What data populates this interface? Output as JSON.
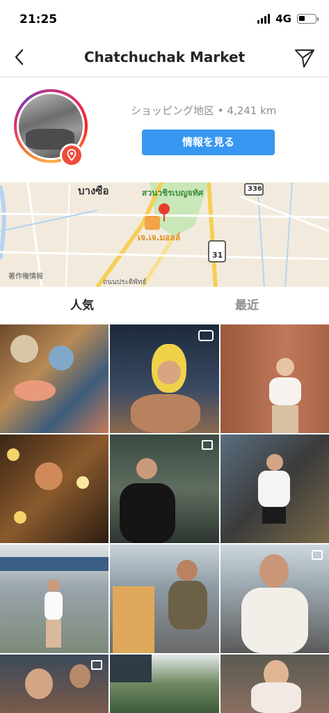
{
  "status_bar": {
    "time": "21:25",
    "network": "4G",
    "battery_level": 0.35
  },
  "header": {
    "title": "Chatchuchak Market"
  },
  "place": {
    "meta": "ショッピング地区 • 4,241 km",
    "info_button": "情報を見る"
  },
  "map": {
    "copyright": "著作権情報",
    "labels": [
      "บางซือ",
      "สวนวชิรเบญจทัศ",
      "เจ.เจ.มอลล์",
      "ถนนประดิพัทธ์",
      "336",
      "31"
    ]
  },
  "tabs": {
    "top": "人気",
    "recent": "最近"
  },
  "grid": {
    "posts": [
      {
        "label": "Tableware shop display",
        "badge": "none"
      },
      {
        "label": "Man in yellow animal hat",
        "badge": "video"
      },
      {
        "label": "Woman in white top by wall",
        "badge": "none"
      },
      {
        "label": "Woman with glowing lights",
        "badge": "none"
      },
      {
        "label": "Man in black at night market",
        "badge": "multiple"
      },
      {
        "label": "Man in white tee at stalls",
        "badge": "none"
      },
      {
        "label": "Woman walking in market",
        "badge": "none"
      },
      {
        "label": "Man with drink on street",
        "badge": "none"
      },
      {
        "label": "Bearded man in white shirt",
        "badge": "multiple"
      },
      {
        "label": "Group selfie",
        "badge": "multiple"
      },
      {
        "label": "Market tents and trees",
        "badge": "none"
      },
      {
        "label": "Woman in crowd",
        "badge": "none"
      }
    ]
  },
  "colors": {
    "accent": "#3897f0",
    "pin": "#ee4d3d",
    "muted": "#8e8e8e"
  }
}
